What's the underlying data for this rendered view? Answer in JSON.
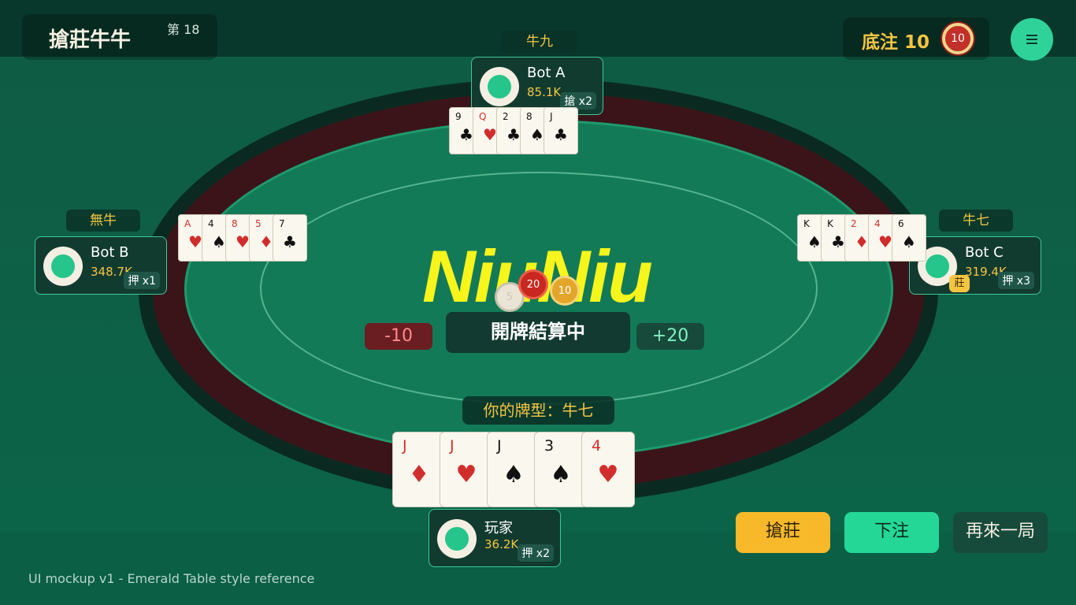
{
  "header": {
    "game_title": "搶莊牛牛",
    "round_label": "第 18",
    "ante_label": "底注 10",
    "ante_chip": "10",
    "menu_icon": "menu-icon"
  },
  "table": {
    "logo": "NiuNiu",
    "status": "開牌結算中",
    "delta_left": "-10",
    "delta_right": "+20",
    "pot_chips": [
      "5",
      "20",
      "10"
    ]
  },
  "players": {
    "bot_a": {
      "name": "Bot A",
      "chips": "85.1K",
      "bet": "搶 x2",
      "hand": "牛九",
      "cards": [
        {
          "rank": "9",
          "suit": "♣",
          "color": "black"
        },
        {
          "rank": "Q",
          "suit": "♥",
          "color": "red"
        },
        {
          "rank": "2",
          "suit": "♣",
          "color": "black"
        },
        {
          "rank": "8",
          "suit": "♠",
          "color": "black"
        },
        {
          "rank": "J",
          "suit": "♣",
          "color": "black"
        }
      ]
    },
    "bot_b": {
      "name": "Bot B",
      "chips": "348.7K",
      "bet": "押 x1",
      "hand": "無牛",
      "cards": [
        {
          "rank": "A",
          "suit": "♥",
          "color": "red"
        },
        {
          "rank": "4",
          "suit": "♠",
          "color": "black"
        },
        {
          "rank": "8",
          "suit": "♥",
          "color": "red"
        },
        {
          "rank": "5",
          "suit": "♦",
          "color": "red"
        },
        {
          "rank": "7",
          "suit": "♣",
          "color": "black"
        }
      ]
    },
    "bot_c": {
      "name": "Bot C",
      "chips": "319.4K",
      "bet": "押 x3",
      "hand": "牛七",
      "dealer_badge": "莊",
      "cards": [
        {
          "rank": "K",
          "suit": "♠",
          "color": "black"
        },
        {
          "rank": "K",
          "suit": "♣",
          "color": "black"
        },
        {
          "rank": "2",
          "suit": "♦",
          "color": "red"
        },
        {
          "rank": "4",
          "suit": "♥",
          "color": "red"
        },
        {
          "rank": "6",
          "suit": "♠",
          "color": "black"
        }
      ]
    },
    "you": {
      "name": "玩家",
      "chips": "36.2K",
      "bet": "押 x2",
      "hand_label": "你的牌型：牛七",
      "cards": [
        {
          "rank": "J",
          "suit": "♦",
          "color": "red"
        },
        {
          "rank": "J",
          "suit": "♥",
          "color": "red"
        },
        {
          "rank": "J",
          "suit": "♠",
          "color": "black"
        },
        {
          "rank": "3",
          "suit": "♠",
          "color": "black"
        },
        {
          "rank": "4",
          "suit": "♥",
          "color": "red"
        }
      ]
    }
  },
  "actions": {
    "grab_dealer": "搶莊",
    "place_bet": "下注",
    "play_again": "再來一局"
  },
  "footer": {
    "note": "UI mockup v1 - Emerald Table style reference"
  },
  "colors": {
    "felt": "#137a58",
    "rail": "#3b1419",
    "accent_gold": "#f5c542",
    "accent_green": "#24d796"
  }
}
